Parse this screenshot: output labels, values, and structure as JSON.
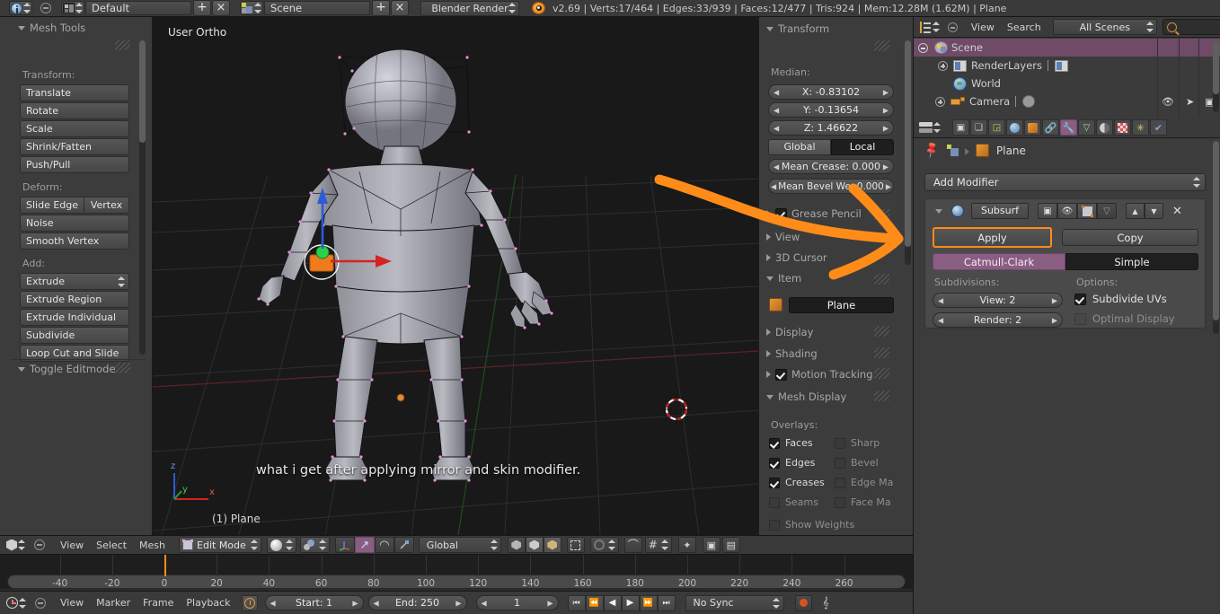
{
  "topbar": {
    "screen_layout": "Default",
    "scene_name": "Scene",
    "render_engine": "Blender Render",
    "status": "v2.69 | Verts:17/464 | Edges:33/939 | Faces:12/477 | Tris:924 | Mem:12.28M (1.62M) | Plane",
    "add_label": "+",
    "close_label": "×"
  },
  "toolshelf": {
    "panel_title": "Mesh Tools",
    "sections": [
      {
        "label": "Transform:",
        "buttons": [
          "Translate",
          "Rotate",
          "Scale",
          "Shrink/Fatten",
          "Push/Pull"
        ]
      },
      {
        "label": "Deform:",
        "buttons": [
          "Slide Edge",
          "Vertex",
          "Noise",
          "Smooth Vertex"
        ]
      },
      {
        "label": "Add:",
        "buttons": [
          "Extrude",
          "Extrude Region",
          "Extrude Individual",
          "Subdivide",
          "Loop Cut and Slide"
        ]
      }
    ],
    "footer_panel": "Toggle Editmode"
  },
  "viewport": {
    "view_name": "User Ortho",
    "object_label": "(1) Plane",
    "caption": "what i get after applying mirror and skin modifier.",
    "axis_x": "x",
    "axis_y": "y",
    "axis_z": "z",
    "header": {
      "menus": [
        "View",
        "Select",
        "Mesh"
      ],
      "mode": "Edit Mode",
      "orientation": "Global"
    }
  },
  "npanel": {
    "transform": {
      "title": "Transform",
      "median_label": "Median:",
      "x": "X: -0.83102",
      "y": "Y: -0.13654",
      "z": "Z: 1.46622",
      "global_label": "Global",
      "local_label": "Local",
      "mean_crease": "Mean Crease: 0.000",
      "mean_bevel": "Mean Bevel We: 0.000"
    },
    "grease_pencil": "Grease Pencil",
    "view_panel": "View",
    "cursor_panel": "3D Cursor",
    "item": {
      "title": "Item",
      "name": "Plane"
    },
    "display_panel": "Display",
    "shading_panel": "Shading",
    "motion_tracking": "Motion Tracking",
    "mesh_display": {
      "title": "Mesh Display",
      "overlays_label": "Overlays:",
      "left": [
        {
          "label": "Faces",
          "checked": true,
          "enabled": true
        },
        {
          "label": "Edges",
          "checked": true,
          "enabled": true
        },
        {
          "label": "Creases",
          "checked": true,
          "enabled": true
        },
        {
          "label": "Seams",
          "checked": false,
          "enabled": false
        },
        {
          "label": "Show Weights",
          "checked": false,
          "enabled": false
        }
      ],
      "right": [
        {
          "label": "Sharp",
          "checked": false,
          "enabled": false
        },
        {
          "label": "Bevel",
          "checked": false,
          "enabled": false
        },
        {
          "label": "Edge Ma",
          "checked": false,
          "enabled": false
        },
        {
          "label": "Face Ma",
          "checked": false,
          "enabled": false
        }
      ]
    }
  },
  "outliner": {
    "menus": [
      "View",
      "Search"
    ],
    "scene_filter": "All Scenes",
    "rows": [
      {
        "label": "Scene",
        "icon": "scene-icon",
        "depth": 0,
        "selected": true,
        "expander": "minus"
      },
      {
        "label": "RenderLayers",
        "icon": "renderlayers-icon",
        "depth": 1,
        "selected": false,
        "expander": "plus"
      },
      {
        "label": "World",
        "icon": "world-icon",
        "depth": 1,
        "selected": false,
        "expander": "none"
      },
      {
        "label": "Camera",
        "icon": "camera-icon",
        "depth": 1,
        "selected": false,
        "expander": "plus"
      }
    ]
  },
  "properties": {
    "breadcrumb_object": "Plane",
    "add_modifier": "Add Modifier",
    "modifier": {
      "name": "Subsurf",
      "apply": "Apply",
      "copy": "Copy",
      "subdivision_types": [
        "Catmull-Clark",
        "Simple"
      ],
      "active_subdivision_type": "Catmull-Clark",
      "subdivisions_label": "Subdivisions:",
      "view": "View: 2",
      "render": "Render: 2",
      "options_label": "Options:",
      "options": [
        {
          "label": "Subdivide UVs",
          "checked": true,
          "enabled": true
        },
        {
          "label": "Optimal Display",
          "checked": false,
          "enabled": false
        }
      ],
      "close_label": "✕"
    }
  },
  "timeline": {
    "menus": [
      "View",
      "Marker",
      "Frame",
      "Playback"
    ],
    "start": "Start: 1",
    "end": "End: 250",
    "current_frame": "1",
    "sync_mode": "No Sync",
    "ticks": [
      -40,
      -20,
      0,
      20,
      40,
      60,
      80,
      100,
      120,
      140,
      160,
      180,
      200,
      220,
      240,
      260
    ],
    "playhead_frame": 1
  },
  "colors": {
    "accent_orange": "#ff8c19",
    "highlight_purple": "#8a5d82",
    "panel_bg": "#3c3c3c",
    "viewport_bg": "#191919",
    "header_bg": "#3a3a3a",
    "selected_row": "#6f4b68"
  }
}
